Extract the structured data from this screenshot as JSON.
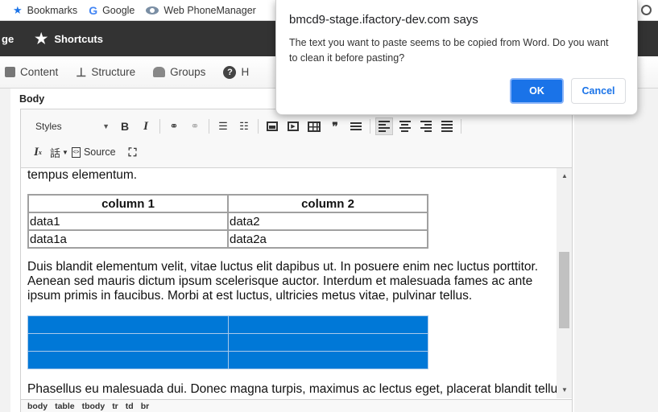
{
  "bookmarks": {
    "items": [
      {
        "label": "Bookmarks",
        "icon": "star-icon"
      },
      {
        "label": "Google",
        "icon": "google-icon"
      },
      {
        "label": "Web PhoneManager",
        "icon": "eye-icon"
      }
    ]
  },
  "admin_toolbar": {
    "truncated_label": "ge",
    "shortcuts_label": "Shortcuts",
    "menu": [
      {
        "label": "Content",
        "icon": "content-icon"
      },
      {
        "label": "Structure",
        "icon": "structure-icon"
      },
      {
        "label": "Groups",
        "icon": "groups-icon"
      },
      {
        "label": "H",
        "icon": "help-icon"
      }
    ]
  },
  "editor": {
    "field_label": "Body",
    "styles_label": "Styles",
    "source_label": "Source",
    "path": [
      "body",
      "table",
      "tbody",
      "tr",
      "td",
      "br"
    ],
    "content": {
      "partial_line": "tempus elementum.",
      "table": {
        "headers": [
          "column 1",
          "column 2"
        ],
        "rows": [
          [
            "data1",
            "data2"
          ],
          [
            "data1a",
            "data2a"
          ]
        ]
      },
      "paragraph": "Duis blandit elementum velit, vitae luctus elit dapibus ut. In posuere enim nec luctus porttitor. Aenean sed mauris dictum ipsum scelerisque auctor. Interdum et malesuada fames ac ante ipsum primis in faucibus. Morbi at est luctus, ultricies metus vitae, pulvinar tellus.",
      "last_paragraph": "Phasellus eu malesuada dui. Donec magna turpis, maximus ac lectus eget, placerat blandit tellus."
    }
  },
  "dialog": {
    "title": "bmcd9-stage.ifactory-dev.com says",
    "message": "The text you want to paste seems to be copied from Word. Do you want to clean it before pasting?",
    "ok_label": "OK",
    "cancel_label": "Cancel"
  },
  "colors": {
    "accent": "#1a73e8",
    "selection_blue": "#0078d7",
    "toolbar_dark": "#333333"
  }
}
